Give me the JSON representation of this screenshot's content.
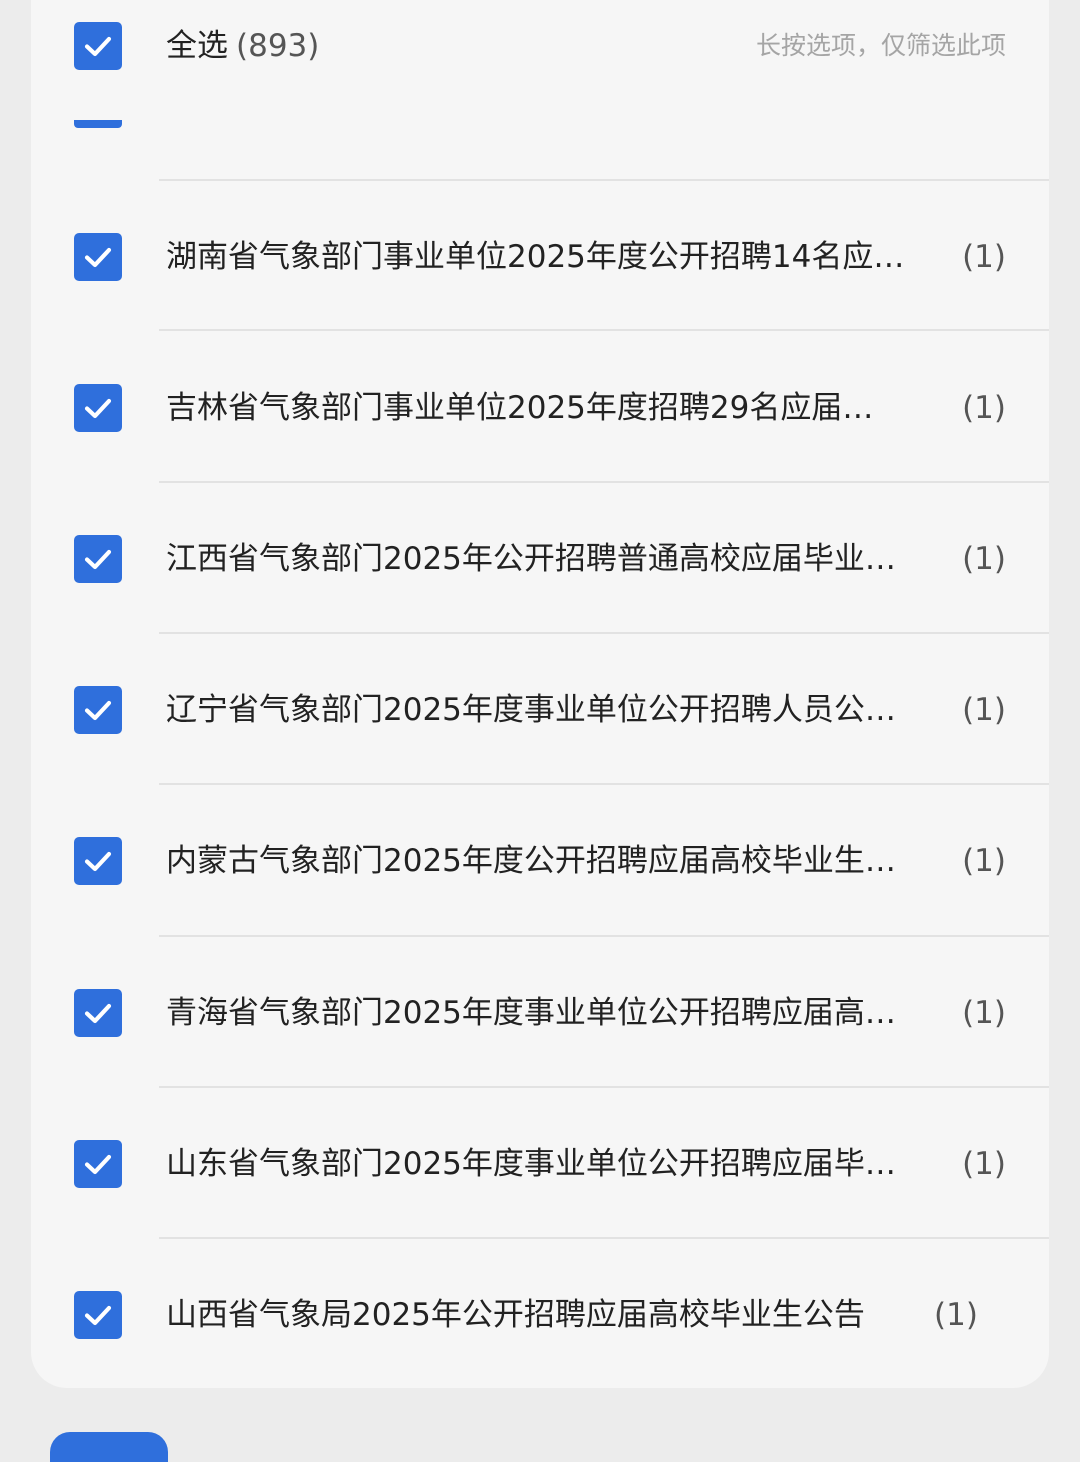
{
  "select_all": {
    "label": "全选",
    "count": "(893)",
    "hint": "长按选项，仅筛选此项"
  },
  "colors": {
    "accent": "#2f6fdc",
    "panel": "#f6f6f6",
    "background": "#ececec"
  },
  "items": [
    {
      "title": "湖南省气象部门事业单位2025年度公开招聘14名应…",
      "count": "(1)"
    },
    {
      "title": "吉林省气象部门事业单位2025年度招聘29名应届…",
      "count": "(1)"
    },
    {
      "title": "江西省气象部门2025年公开招聘普通高校应届毕业…",
      "count": "(1)"
    },
    {
      "title": "辽宁省气象部门2025年度事业单位公开招聘人员公…",
      "count": "(1)"
    },
    {
      "title": "内蒙古气象部门2025年度公开招聘应届高校毕业生…",
      "count": "(1)"
    },
    {
      "title": "青海省气象部门2025年度事业单位公开招聘应届高…",
      "count": "(1)"
    },
    {
      "title": "山东省气象部门2025年度事业单位公开招聘应届毕…",
      "count": "(1)"
    },
    {
      "title": "山西省气象局2025年公开招聘应届高校毕业生公告",
      "count": "(1)"
    }
  ]
}
